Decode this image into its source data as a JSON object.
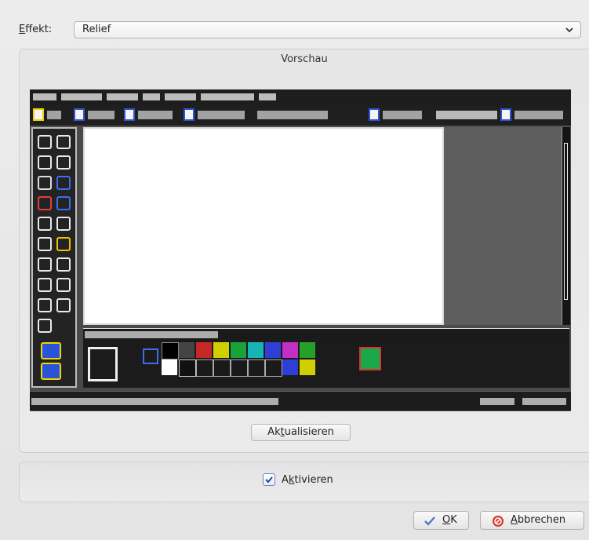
{
  "effect": {
    "label_first": "E",
    "label_rest": "ffekt:",
    "selected": "Relief"
  },
  "preview": {
    "title": "Vorschau",
    "refresh_pre": "Ak",
    "refresh_key": "t",
    "refresh_post": "ualisieren"
  },
  "activate": {
    "checked": true,
    "label_pre": "A",
    "label_key": "k",
    "label_post": "tivieren"
  },
  "buttons": {
    "ok_key": "O",
    "ok_rest": "K",
    "cancel_key": "A",
    "cancel_rest": "bbrechen"
  },
  "colors": {
    "accent": "#2a5ea8",
    "cancel_icon": "#d23b2a",
    "ok_icon": "#4f78b8"
  },
  "icons": {
    "dropdown": "chevron-down-icon",
    "checkbox": "check-icon",
    "ok": "check-icon",
    "cancel": "cancel-icon"
  }
}
